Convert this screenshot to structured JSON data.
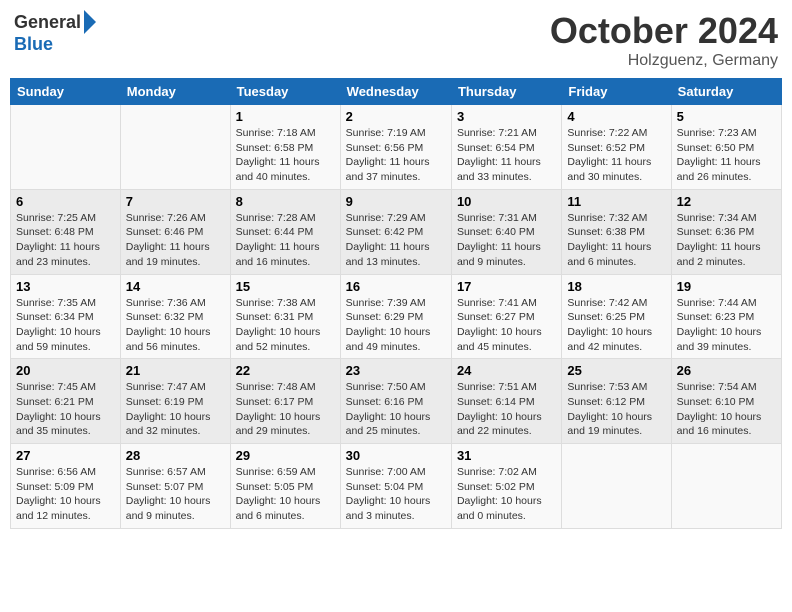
{
  "header": {
    "logo_general": "General",
    "logo_blue": "Blue",
    "month_title": "October 2024",
    "location": "Holzguenz, Germany"
  },
  "days_of_week": [
    "Sunday",
    "Monday",
    "Tuesday",
    "Wednesday",
    "Thursday",
    "Friday",
    "Saturday"
  ],
  "weeks": [
    [
      null,
      null,
      {
        "day": "1",
        "sunrise": "Sunrise: 7:18 AM",
        "sunset": "Sunset: 6:58 PM",
        "daylight": "Daylight: 11 hours and 40 minutes."
      },
      {
        "day": "2",
        "sunrise": "Sunrise: 7:19 AM",
        "sunset": "Sunset: 6:56 PM",
        "daylight": "Daylight: 11 hours and 37 minutes."
      },
      {
        "day": "3",
        "sunrise": "Sunrise: 7:21 AM",
        "sunset": "Sunset: 6:54 PM",
        "daylight": "Daylight: 11 hours and 33 minutes."
      },
      {
        "day": "4",
        "sunrise": "Sunrise: 7:22 AM",
        "sunset": "Sunset: 6:52 PM",
        "daylight": "Daylight: 11 hours and 30 minutes."
      },
      {
        "day": "5",
        "sunrise": "Sunrise: 7:23 AM",
        "sunset": "Sunset: 6:50 PM",
        "daylight": "Daylight: 11 hours and 26 minutes."
      }
    ],
    [
      {
        "day": "6",
        "sunrise": "Sunrise: 7:25 AM",
        "sunset": "Sunset: 6:48 PM",
        "daylight": "Daylight: 11 hours and 23 minutes."
      },
      {
        "day": "7",
        "sunrise": "Sunrise: 7:26 AM",
        "sunset": "Sunset: 6:46 PM",
        "daylight": "Daylight: 11 hours and 19 minutes."
      },
      {
        "day": "8",
        "sunrise": "Sunrise: 7:28 AM",
        "sunset": "Sunset: 6:44 PM",
        "daylight": "Daylight: 11 hours and 16 minutes."
      },
      {
        "day": "9",
        "sunrise": "Sunrise: 7:29 AM",
        "sunset": "Sunset: 6:42 PM",
        "daylight": "Daylight: 11 hours and 13 minutes."
      },
      {
        "day": "10",
        "sunrise": "Sunrise: 7:31 AM",
        "sunset": "Sunset: 6:40 PM",
        "daylight": "Daylight: 11 hours and 9 minutes."
      },
      {
        "day": "11",
        "sunrise": "Sunrise: 7:32 AM",
        "sunset": "Sunset: 6:38 PM",
        "daylight": "Daylight: 11 hours and 6 minutes."
      },
      {
        "day": "12",
        "sunrise": "Sunrise: 7:34 AM",
        "sunset": "Sunset: 6:36 PM",
        "daylight": "Daylight: 11 hours and 2 minutes."
      }
    ],
    [
      {
        "day": "13",
        "sunrise": "Sunrise: 7:35 AM",
        "sunset": "Sunset: 6:34 PM",
        "daylight": "Daylight: 10 hours and 59 minutes."
      },
      {
        "day": "14",
        "sunrise": "Sunrise: 7:36 AM",
        "sunset": "Sunset: 6:32 PM",
        "daylight": "Daylight: 10 hours and 56 minutes."
      },
      {
        "day": "15",
        "sunrise": "Sunrise: 7:38 AM",
        "sunset": "Sunset: 6:31 PM",
        "daylight": "Daylight: 10 hours and 52 minutes."
      },
      {
        "day": "16",
        "sunrise": "Sunrise: 7:39 AM",
        "sunset": "Sunset: 6:29 PM",
        "daylight": "Daylight: 10 hours and 49 minutes."
      },
      {
        "day": "17",
        "sunrise": "Sunrise: 7:41 AM",
        "sunset": "Sunset: 6:27 PM",
        "daylight": "Daylight: 10 hours and 45 minutes."
      },
      {
        "day": "18",
        "sunrise": "Sunrise: 7:42 AM",
        "sunset": "Sunset: 6:25 PM",
        "daylight": "Daylight: 10 hours and 42 minutes."
      },
      {
        "day": "19",
        "sunrise": "Sunrise: 7:44 AM",
        "sunset": "Sunset: 6:23 PM",
        "daylight": "Daylight: 10 hours and 39 minutes."
      }
    ],
    [
      {
        "day": "20",
        "sunrise": "Sunrise: 7:45 AM",
        "sunset": "Sunset: 6:21 PM",
        "daylight": "Daylight: 10 hours and 35 minutes."
      },
      {
        "day": "21",
        "sunrise": "Sunrise: 7:47 AM",
        "sunset": "Sunset: 6:19 PM",
        "daylight": "Daylight: 10 hours and 32 minutes."
      },
      {
        "day": "22",
        "sunrise": "Sunrise: 7:48 AM",
        "sunset": "Sunset: 6:17 PM",
        "daylight": "Daylight: 10 hours and 29 minutes."
      },
      {
        "day": "23",
        "sunrise": "Sunrise: 7:50 AM",
        "sunset": "Sunset: 6:16 PM",
        "daylight": "Daylight: 10 hours and 25 minutes."
      },
      {
        "day": "24",
        "sunrise": "Sunrise: 7:51 AM",
        "sunset": "Sunset: 6:14 PM",
        "daylight": "Daylight: 10 hours and 22 minutes."
      },
      {
        "day": "25",
        "sunrise": "Sunrise: 7:53 AM",
        "sunset": "Sunset: 6:12 PM",
        "daylight": "Daylight: 10 hours and 19 minutes."
      },
      {
        "day": "26",
        "sunrise": "Sunrise: 7:54 AM",
        "sunset": "Sunset: 6:10 PM",
        "daylight": "Daylight: 10 hours and 16 minutes."
      }
    ],
    [
      {
        "day": "27",
        "sunrise": "Sunrise: 6:56 AM",
        "sunset": "Sunset: 5:09 PM",
        "daylight": "Daylight: 10 hours and 12 minutes."
      },
      {
        "day": "28",
        "sunrise": "Sunrise: 6:57 AM",
        "sunset": "Sunset: 5:07 PM",
        "daylight": "Daylight: 10 hours and 9 minutes."
      },
      {
        "day": "29",
        "sunrise": "Sunrise: 6:59 AM",
        "sunset": "Sunset: 5:05 PM",
        "daylight": "Daylight: 10 hours and 6 minutes."
      },
      {
        "day": "30",
        "sunrise": "Sunrise: 7:00 AM",
        "sunset": "Sunset: 5:04 PM",
        "daylight": "Daylight: 10 hours and 3 minutes."
      },
      {
        "day": "31",
        "sunrise": "Sunrise: 7:02 AM",
        "sunset": "Sunset: 5:02 PM",
        "daylight": "Daylight: 10 hours and 0 minutes."
      },
      null,
      null
    ]
  ]
}
